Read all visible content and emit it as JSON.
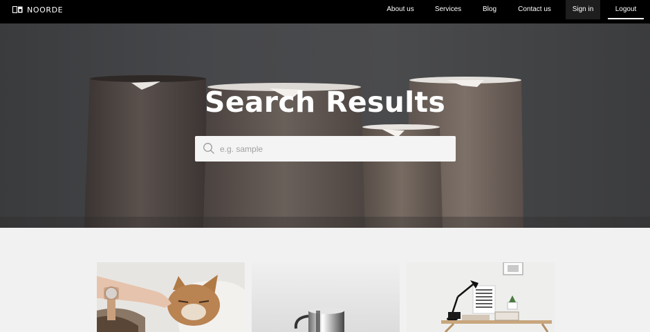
{
  "nav": {
    "brand": "NOORDE",
    "brand_icon": "logo-icon",
    "items": [
      {
        "label": "About us"
      },
      {
        "label": "Services"
      },
      {
        "label": "Blog"
      },
      {
        "label": "Contact us"
      },
      {
        "label": "Sign in"
      },
      {
        "label": "Logout"
      }
    ]
  },
  "hero": {
    "title": "Search Results",
    "search": {
      "placeholder": "e.g. sample",
      "value": "",
      "icon": "search-icon"
    }
  },
  "cards": [
    {
      "image": "cat-with-hand-photo"
    },
    {
      "image": "ceramic-mug-photo"
    },
    {
      "image": "desk-lamp-workspace-photo"
    }
  ],
  "colors": {
    "navbar": "#000000",
    "signin_bg": "#1e1e1e",
    "page_bg": "#f1f1f1",
    "search_bg": "#f4f4f4"
  }
}
